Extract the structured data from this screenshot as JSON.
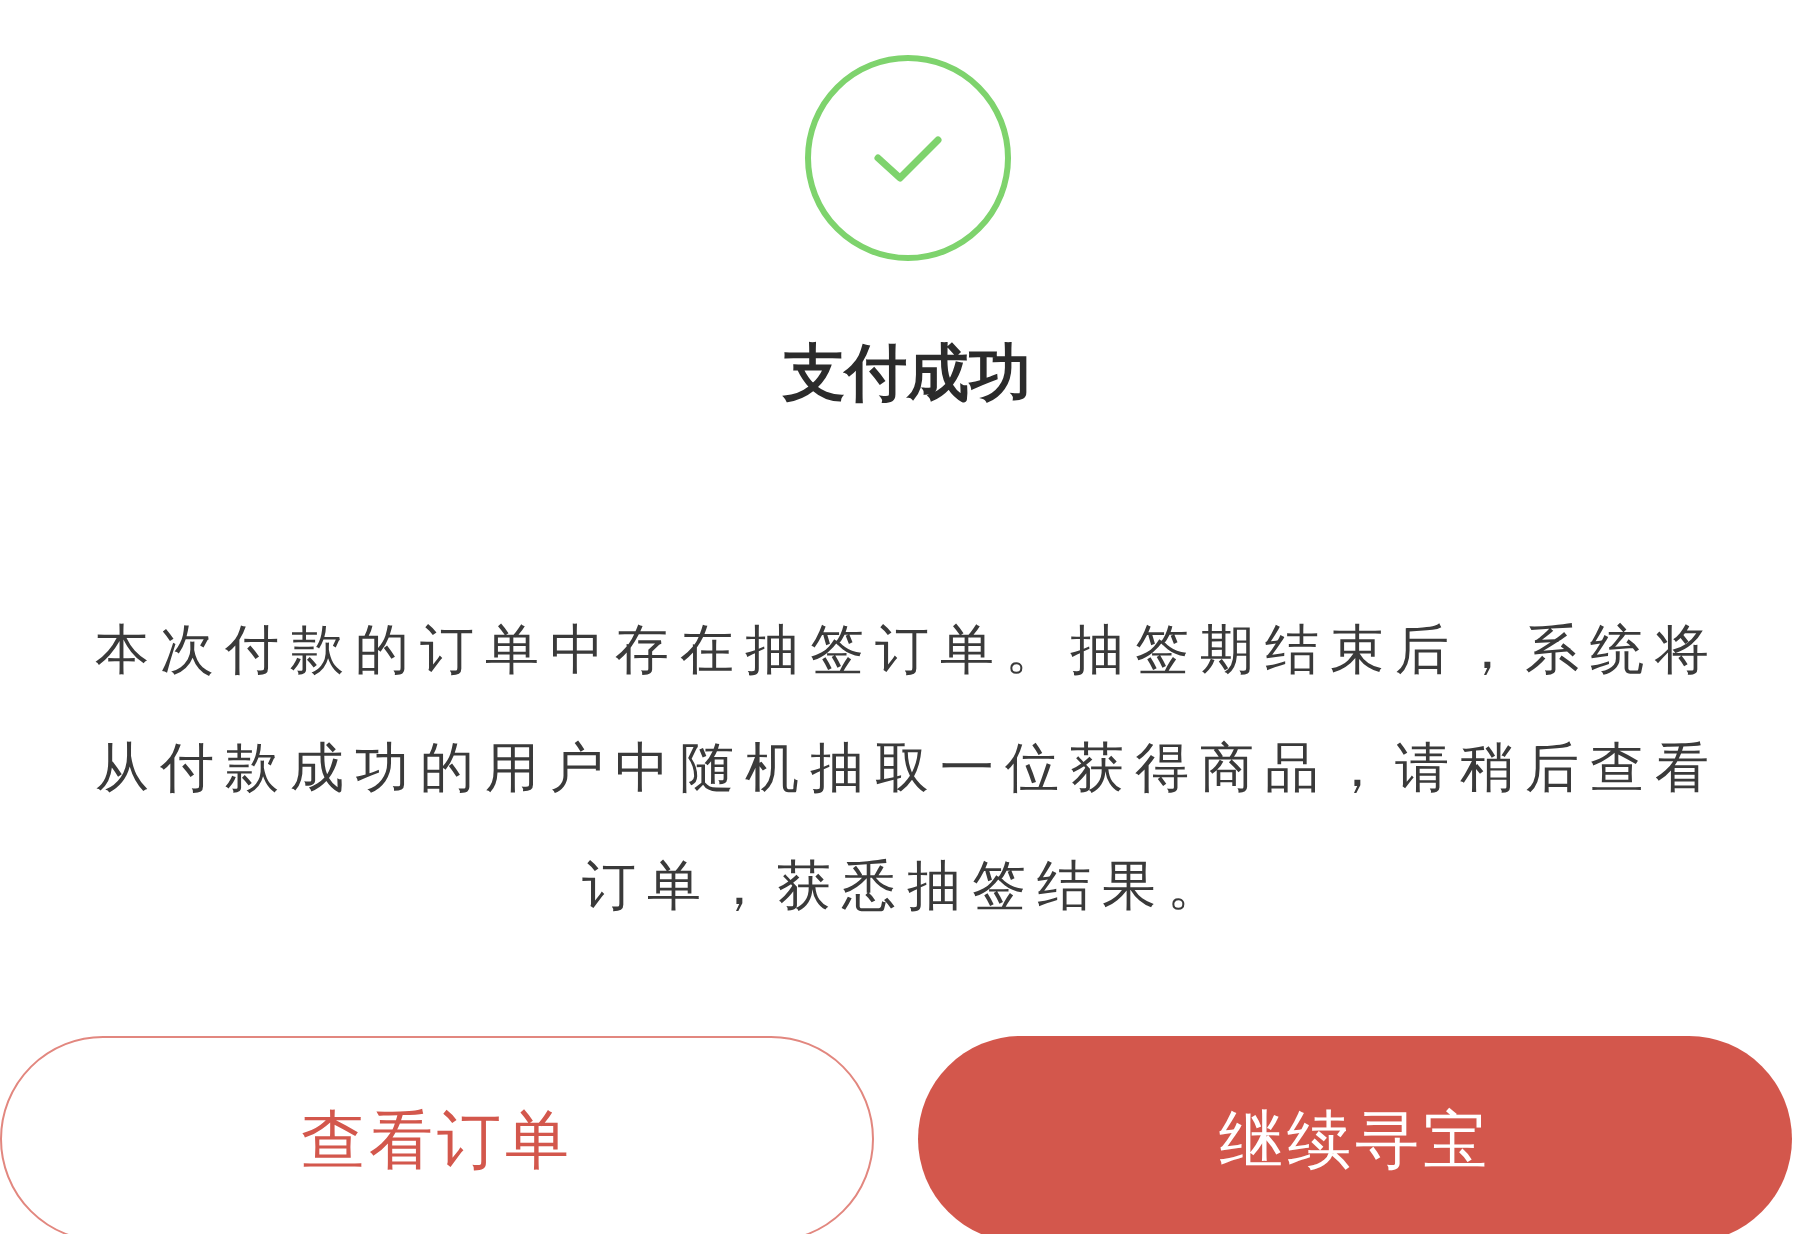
{
  "status": {
    "title": "支付成功",
    "message": "本次付款的订单中存在抽签订单。抽签期结束后，系统将从付款成功的用户中随机抽取一位获得商品，请稍后查看订单，获悉抽签结果。"
  },
  "buttons": [
    {
      "label": "查看订单",
      "kind": "outline"
    },
    {
      "label": "继续寻宝",
      "kind": "filled"
    }
  ]
}
